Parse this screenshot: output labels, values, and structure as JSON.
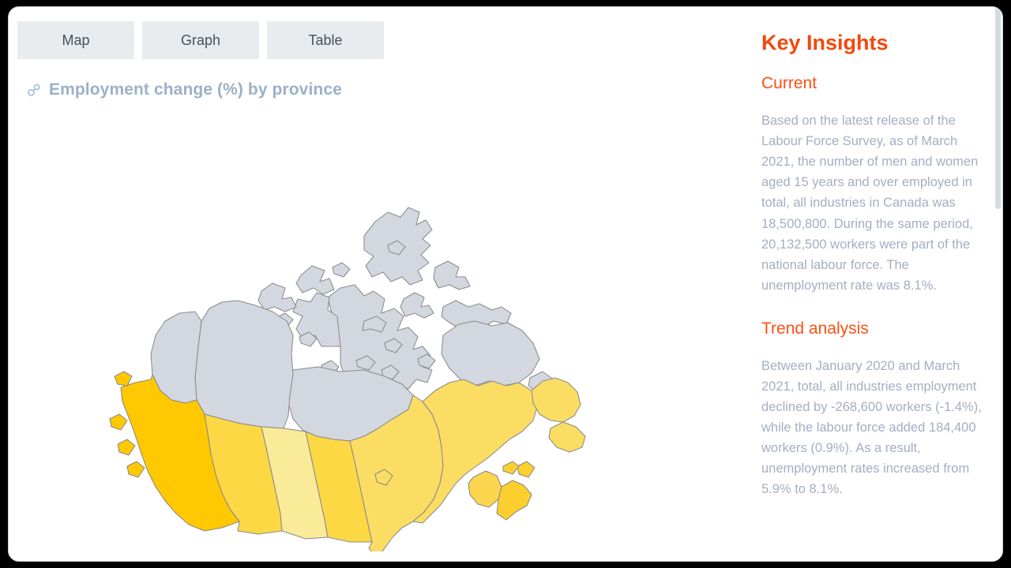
{
  "tabs": [
    {
      "id": "map",
      "label": "Map"
    },
    {
      "id": "graph",
      "label": "Graph"
    },
    {
      "id": "table",
      "label": "Table"
    }
  ],
  "map_panel": {
    "link_icon": "link-icon",
    "title": "Employment change (%) by province"
  },
  "insights": {
    "title": "Key Insights",
    "sections": [
      {
        "heading": "Current",
        "body": "Based on the latest release of the Labour Force Survey, as of March 2021, the number of men and women aged 15 years and over employed in total, all industries in Canada was 18,500,800. During the same period, 20,132,500 workers were part of the national labour force. The unemployment rate was 8.1%."
      },
      {
        "heading": "Trend analysis",
        "body": "Between January 2020 and March 2021, total, all industries employment declined by -268,600 workers (-1.4%), while the labour force added 184,400 workers (0.9%). As a result, unemployment rates increased from 5.9% to 8.1%."
      }
    ]
  },
  "chart_data": {
    "type": "choropleth",
    "title": "Employment change (%) by province",
    "regions": [
      {
        "name": "British Columbia",
        "code": "BC",
        "fill": "#ffc800",
        "level": "high"
      },
      {
        "name": "Alberta",
        "code": "AB",
        "fill": "#fcd944",
        "level": "medium-high"
      },
      {
        "name": "Saskatchewan",
        "code": "SK",
        "fill": "#faeb99",
        "level": "low"
      },
      {
        "name": "Manitoba",
        "code": "MB",
        "fill": "#fcd944",
        "level": "medium-high"
      },
      {
        "name": "Ontario",
        "code": "ON",
        "fill": "#fbdd64",
        "level": "medium"
      },
      {
        "name": "Quebec",
        "code": "QC",
        "fill": "#fbdd64",
        "level": "medium"
      },
      {
        "name": "New Brunswick",
        "code": "NB",
        "fill": "#fbd54e",
        "level": "medium"
      },
      {
        "name": "Nova Scotia",
        "code": "NS",
        "fill": "#fcce2e",
        "level": "medium-high"
      },
      {
        "name": "Prince Edward Island",
        "code": "PE",
        "fill": "#fcce2e",
        "level": "medium-high"
      },
      {
        "name": "Newfoundland and Labrador",
        "code": "NL",
        "fill": "#fbdd64",
        "level": "medium"
      },
      {
        "name": "Yukon",
        "code": "YT",
        "fill": "#d3d8e0",
        "level": "no data"
      },
      {
        "name": "Northwest Territories",
        "code": "NT",
        "fill": "#d3d8e0",
        "level": "no data"
      },
      {
        "name": "Nunavut",
        "code": "NU",
        "fill": "#d3d8e0",
        "level": "no data"
      }
    ],
    "colors": {
      "accent": "#f4480c",
      "muted_text": "#a4aec2",
      "tab_bg": "#e9ecef",
      "no_data": "#d3d8e0",
      "stroke": "#8a8a8a"
    }
  }
}
